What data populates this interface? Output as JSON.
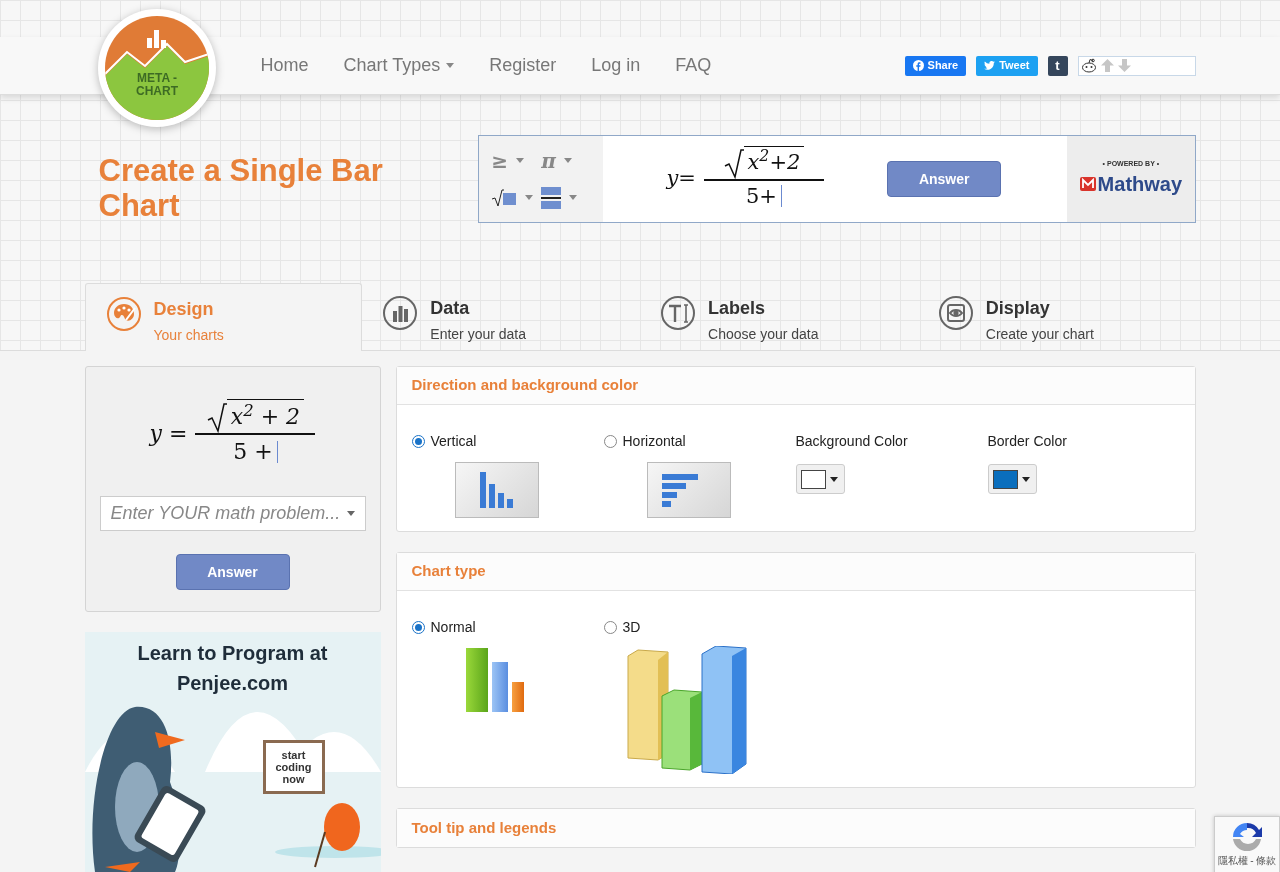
{
  "logo": {
    "line1": "META -",
    "line2": "CHART"
  },
  "nav": [
    {
      "label": "Home",
      "has_caret": false
    },
    {
      "label": "Chart Types",
      "has_caret": true
    },
    {
      "label": "Register",
      "has_caret": false
    },
    {
      "label": "Log in",
      "has_caret": false
    },
    {
      "label": "FAQ",
      "has_caret": false
    }
  ],
  "social": [
    {
      "kind": "facebook",
      "label": "Share"
    },
    {
      "kind": "twitter",
      "label": "Tweet"
    },
    {
      "kind": "tumblr",
      "label": "t"
    },
    {
      "kind": "reddit"
    }
  ],
  "page_title": "Create a Single Bar Chart",
  "mathway_widget": {
    "symbols": [
      {
        "kind": "text",
        "label": "≥"
      },
      {
        "kind": "text",
        "label": "π"
      },
      {
        "kind": "sqrt"
      },
      {
        "kind": "fraction"
      }
    ],
    "formula": {
      "lhs": "y=",
      "numerator": "x$^{2}$+2",
      "denominator": "5+"
    },
    "button": "Answer",
    "powered_by": "• POWERED BY •",
    "brand": "Mathway"
  },
  "tabs": [
    {
      "kind": "palette",
      "title": "Design",
      "subtitle": "Your charts",
      "selected": true
    },
    {
      "kind": "bars",
      "title": "Data",
      "subtitle": "Enter your data",
      "selected": false
    },
    {
      "kind": "text",
      "title": "Labels",
      "subtitle": "Choose your data",
      "selected": false
    },
    {
      "kind": "display",
      "title": "Display",
      "subtitle": "Create your chart",
      "selected": false
    }
  ],
  "math_panel": {
    "formula": {
      "lhs": "y =",
      "numerator": "x$^{2}$ + 2",
      "denominator": "5 +"
    },
    "placeholder": "Enter YOUR math problem...",
    "button": "Answer"
  },
  "ad": {
    "heading_line1": "Learn to Program at",
    "heading_line2": "Penjee.com",
    "sign": "start coding now"
  },
  "sections": [
    {
      "kind": "direction",
      "title": "Direction and background color",
      "options": [
        {
          "kind": "vertical",
          "label": "Vertical",
          "selected": true
        },
        {
          "kind": "horizontal",
          "label": "Horizontal",
          "selected": false
        }
      ],
      "colors": [
        {
          "label": "Background Color",
          "color": "#ffffff"
        },
        {
          "label": "Border Color",
          "color": "#0a6ebd"
        }
      ]
    },
    {
      "kind": "chart_type",
      "title": "Chart type",
      "options": [
        {
          "kind": "normal",
          "label": "Normal",
          "selected": true
        },
        {
          "kind": "perspective",
          "label": "3D",
          "selected": false
        }
      ]
    },
    {
      "kind": "collapsed",
      "title": "Tool tip and legends"
    }
  ],
  "recaptcha": {
    "text": "隱私權 - 條款"
  }
}
